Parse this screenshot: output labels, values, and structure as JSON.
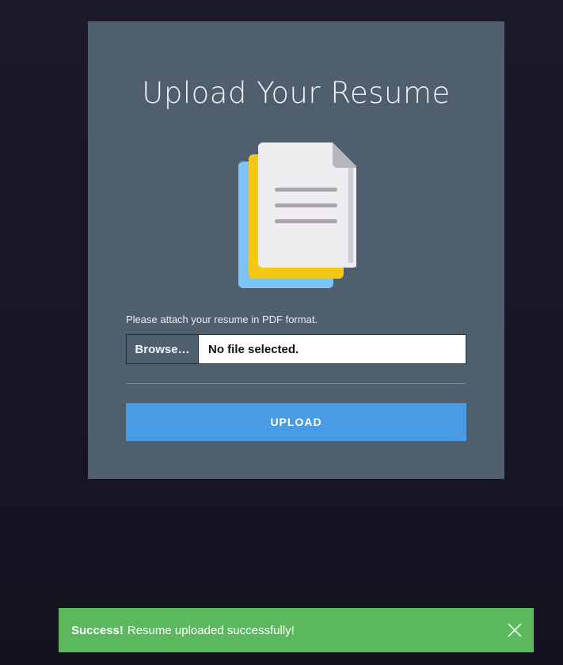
{
  "card": {
    "title": "Upload Your Resume",
    "illustration_icon": "document-stack-icon",
    "hint": "Please attach your resume in PDF format.",
    "browse_label": "Browse…",
    "file_status": "No file selected.",
    "upload_label": "UPLOAD"
  },
  "toast": {
    "title": "Success!",
    "message": "Resume uploaded successfully!",
    "close_icon": "close-icon"
  },
  "colors": {
    "background": "#161625",
    "card": "#4f5f6e",
    "upload_button": "#4a9be6",
    "toast_success": "#5cb85c",
    "sheet_blue": "#7ec3f5",
    "sheet_yellow": "#f7c813",
    "sheet_white": "#efedf0"
  }
}
